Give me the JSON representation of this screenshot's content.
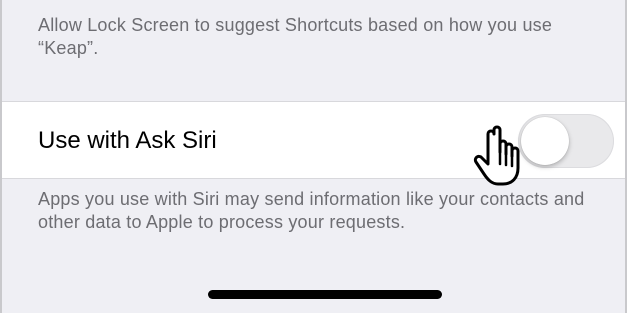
{
  "lock_screen_footer": {
    "text": "Allow Lock Screen to suggest Shortcuts based on how you use “Keap”."
  },
  "ask_siri_cell": {
    "label": "Use with Ask Siri",
    "toggle_state": "off"
  },
  "siri_footer": {
    "text": "Apps you use with Siri may send information like your contacts and other data to Apple to process your requests."
  },
  "colors": {
    "group_background": "#efeff4",
    "footer_text": "#6d6d72",
    "toggle_off": "#e9e9eb"
  },
  "icons": {
    "cursor": "hand-pointer-icon"
  }
}
